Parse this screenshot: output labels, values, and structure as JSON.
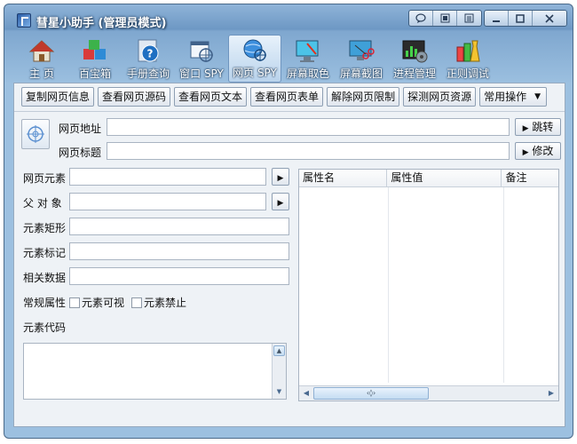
{
  "window": {
    "title": "彗星小助手 (管理员模式)"
  },
  "titlebar_buttons": [
    "chat-icon",
    "skin-icon",
    "menu-icon",
    "minimize-icon",
    "maximize-icon",
    "close-icon"
  ],
  "toolbar": {
    "items": [
      {
        "label": "主 页",
        "icon": "home-icon"
      },
      {
        "label": "百宝箱",
        "icon": "cubes-icon"
      },
      {
        "label": "手册查询",
        "icon": "help-icon"
      },
      {
        "label": "窗口 SPY",
        "icon": "window-target-icon"
      },
      {
        "label": "网页 SPY",
        "icon": "globe-target-icon",
        "active": true
      },
      {
        "label": "屏幕取色",
        "icon": "color-picker-icon"
      },
      {
        "label": "屏幕截图",
        "icon": "scissors-icon"
      },
      {
        "label": "进程管理",
        "icon": "process-gear-icon"
      },
      {
        "label": "正则调试",
        "icon": "flask-icon"
      }
    ]
  },
  "actions": {
    "copy_info": "复制网页信息",
    "view_source": "查看网页源码",
    "view_text": "查看网页文本",
    "view_form": "查看网页表单",
    "unlock_limits": "解除网页限制",
    "probe_resources": "探测网页资源",
    "common_ops": "常用操作"
  },
  "page": {
    "url_label": "网页地址",
    "url_value": "",
    "title_label": "网页标题",
    "title_value": "",
    "goto_button": "跳转",
    "edit_button": "修改"
  },
  "element": {
    "element_label": "网页元素",
    "parent_label": "父 对 象",
    "rect_label": "元素矩形",
    "tag_label": "元素标记",
    "data_label": "相关数据",
    "attr_label": "常规属性",
    "visible_label": "元素可视",
    "disabled_label": "元素禁止",
    "code_label": "元素代码"
  },
  "grid": {
    "columns": [
      "属性名",
      "属性值",
      "备注"
    ]
  },
  "colors": {
    "title_gradient_top": "#8fb4d8",
    "client_background": "#eef2f6"
  }
}
